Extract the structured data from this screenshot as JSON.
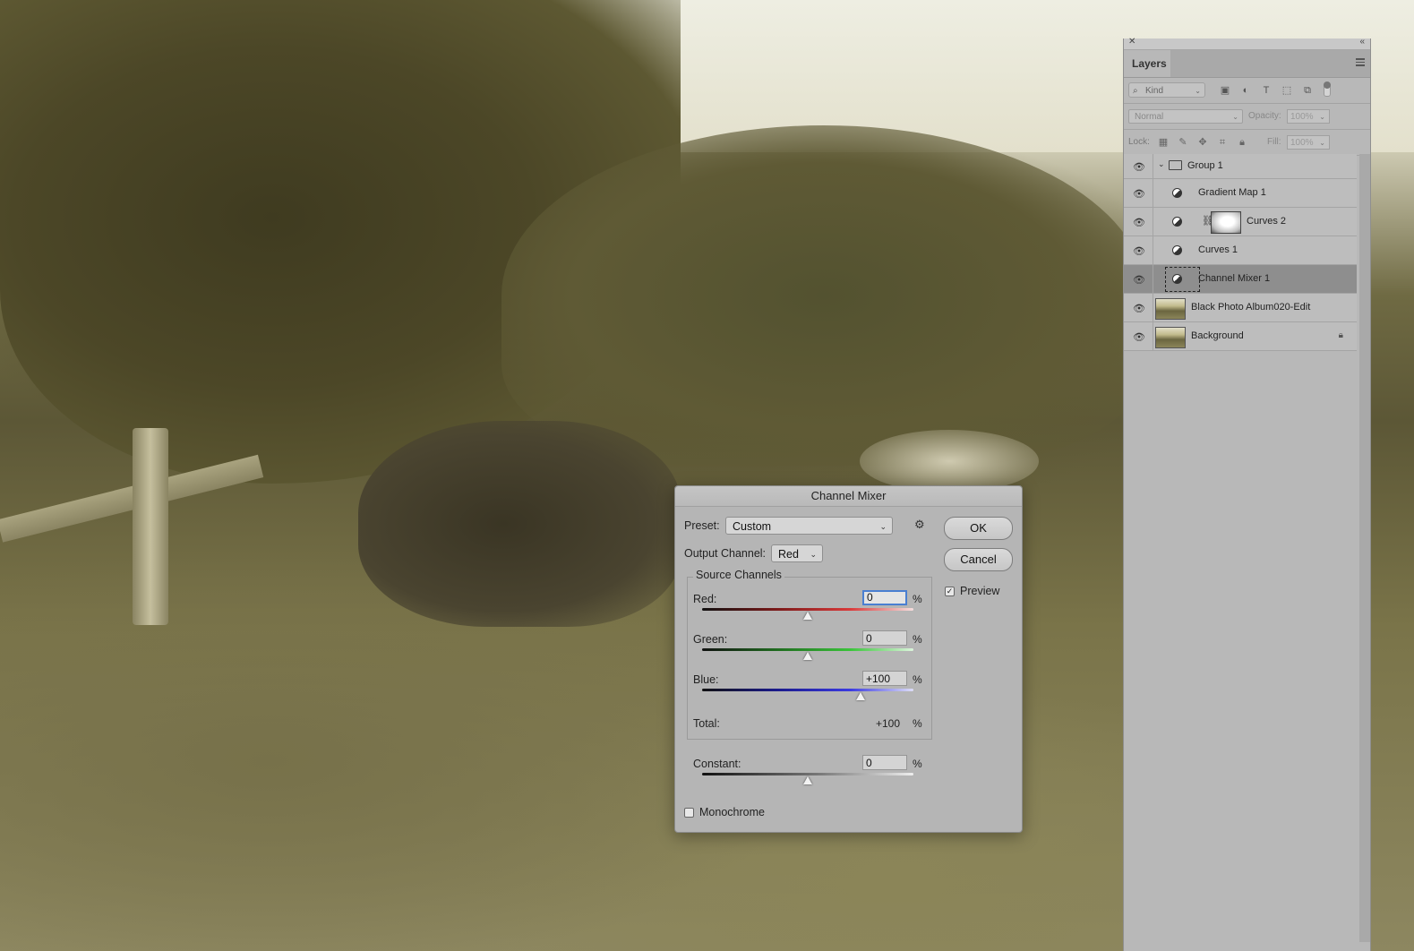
{
  "layers_panel": {
    "tab_label": "Layers",
    "kind_label": "Kind",
    "blend_mode": "Normal",
    "opacity_label": "Opacity:",
    "opacity_value": "100%",
    "lock_label": "Lock:",
    "fill_label": "Fill:",
    "fill_value": "100%",
    "layers": [
      {
        "name": "Group 1",
        "type": "group"
      },
      {
        "name": "Gradient Map 1",
        "type": "adjustment"
      },
      {
        "name": "Curves 2",
        "type": "adjustment-masked"
      },
      {
        "name": "Curves 1",
        "type": "adjustment"
      },
      {
        "name": "Channel Mixer 1",
        "type": "adjustment",
        "selected": true
      },
      {
        "name": "Black Photo Album020-Edit",
        "type": "pixel"
      },
      {
        "name": "Background",
        "type": "pixel",
        "locked": true
      }
    ]
  },
  "dialog": {
    "title": "Channel Mixer",
    "preset_label": "Preset:",
    "preset_value": "Custom",
    "output_label": "Output Channel:",
    "output_value": "Red",
    "ok_label": "OK",
    "cancel_label": "Cancel",
    "preview_label": "Preview",
    "preview_checked": true,
    "source_channels_label": "Source Channels",
    "red_label": "Red:",
    "red_value": "0",
    "green_label": "Green:",
    "green_value": "0",
    "blue_label": "Blue:",
    "blue_value": "+100",
    "percent": "%",
    "total_label": "Total:",
    "total_value": "+100",
    "constant_label": "Constant:",
    "constant_value": "0",
    "monochrome_label": "Monochrome",
    "monochrome_checked": false,
    "slider_levels": {
      "red": 0,
      "green": 0,
      "blue": 100,
      "constant": 0
    }
  },
  "icons": {
    "eye": "eye-icon",
    "gear": "gear-icon",
    "lock": "lock-icon",
    "folder": "folder-icon",
    "chain": "chain-icon"
  }
}
